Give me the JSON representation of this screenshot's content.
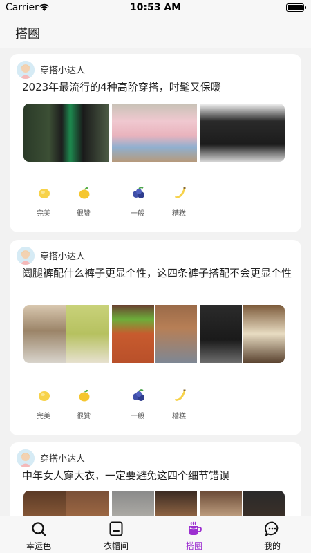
{
  "status_bar": {
    "carrier": "Carrier",
    "time": "10:53 AM"
  },
  "nav": {
    "title": "搭圈"
  },
  "posts": [
    {
      "author": "穿搭小达人",
      "title": "2023年最流行的4种高阶穿搭，时髦又保暖"
    },
    {
      "author": "穿搭小达人",
      "title": "阔腿裤配什么裤子更显个性，这四条裤子搭配不会更显个性"
    },
    {
      "author": "穿搭小达人",
      "title": "中年女人穿大衣，一定要避免这四个细节错误"
    }
  ],
  "reactions": [
    {
      "label": "完美",
      "icon": "lemon-icon"
    },
    {
      "label": "很赞",
      "icon": "lemon-leaf-icon"
    },
    {
      "label": "一般",
      "icon": "blueberry-icon"
    },
    {
      "label": "糟糕",
      "icon": "banana-icon"
    }
  ],
  "tabs": [
    {
      "label": "幸运色",
      "icon": "search-icon"
    },
    {
      "label": "衣帽间",
      "icon": "wardrobe-icon"
    },
    {
      "label": "搭圈",
      "icon": "coffee-cup-icon"
    },
    {
      "label": "我的",
      "icon": "chat-bubble-icon"
    }
  ],
  "colors": {
    "accent": "#9c2fd0",
    "background": "#f2f2f2",
    "card": "#ffffff"
  }
}
